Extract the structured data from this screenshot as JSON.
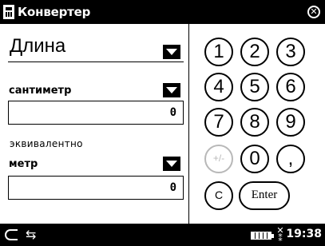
{
  "titlebar": {
    "title": "Конвертер",
    "app_icon": "calculator-icon",
    "close_icon": "close-icon",
    "close_glyph": "✕"
  },
  "converter": {
    "category": "Длина",
    "from_unit": "сантиметр",
    "from_value": "0",
    "equivalent_label": "эквивалентно",
    "to_unit": "метр",
    "to_value": "0"
  },
  "keypad": {
    "keys": [
      "1",
      "2",
      "3",
      "4",
      "5",
      "6",
      "7",
      "8",
      "9",
      "+/-",
      "0",
      ",",
      "C",
      "Enter"
    ],
    "disabled_keys": [
      "+/-"
    ]
  },
  "taskbar": {
    "back_icon": "back-arrow-icon",
    "sync_icon": "sync-icon",
    "battery_icon": "battery-icon",
    "signal_icon": "antenna-icon",
    "antenna_glyph": "✕\n⁑",
    "clock": "19:38"
  },
  "colors": {
    "bar": "#000000",
    "background": "#ffffff",
    "disabled": "#b8b8b8"
  }
}
